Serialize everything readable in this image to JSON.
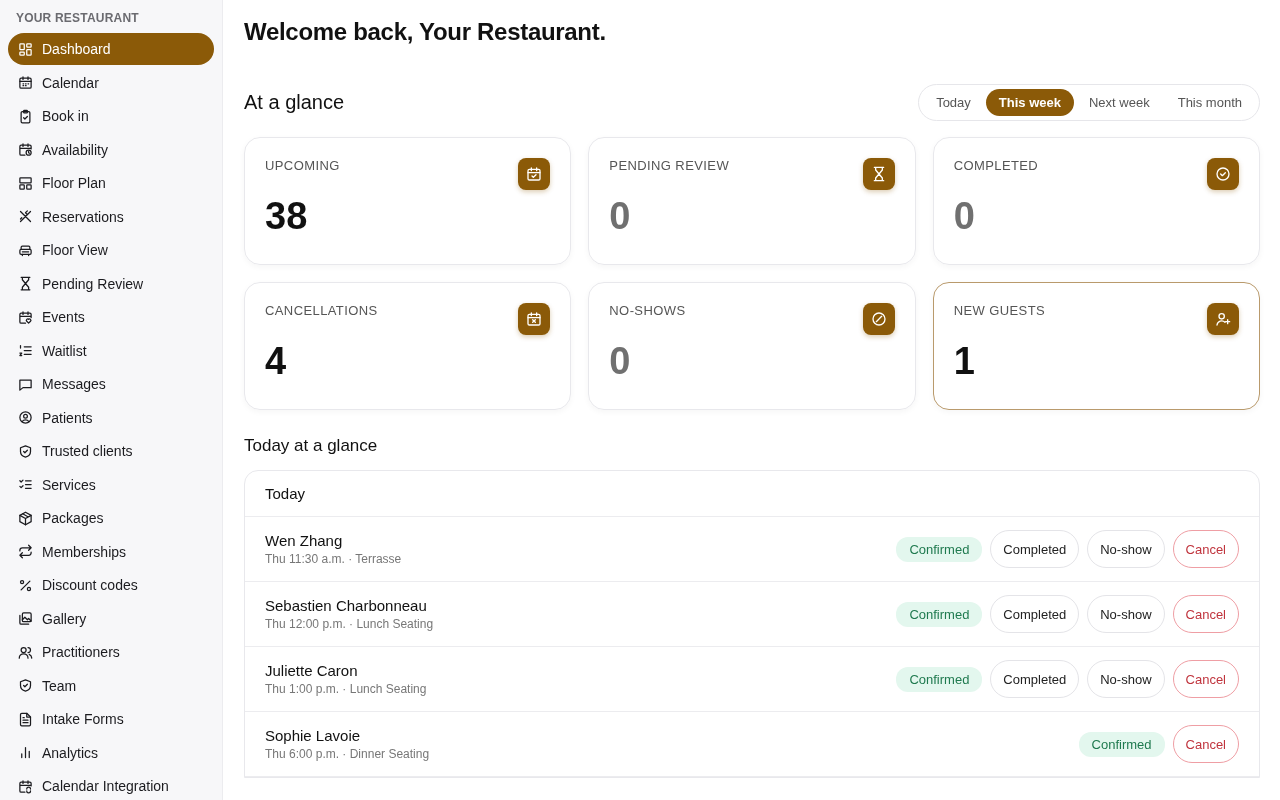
{
  "sidebar": {
    "heading": "YOUR RESTAURANT",
    "items": [
      {
        "label": "Dashboard",
        "selected": true
      },
      {
        "label": "Calendar",
        "selected": false
      },
      {
        "label": "Book in",
        "selected": false
      },
      {
        "label": "Availability",
        "selected": false
      },
      {
        "label": "Floor Plan",
        "selected": false
      },
      {
        "label": "Reservations",
        "selected": false
      },
      {
        "label": "Floor View",
        "selected": false
      },
      {
        "label": "Pending Review",
        "selected": false
      },
      {
        "label": "Events",
        "selected": false
      },
      {
        "label": "Waitlist",
        "selected": false
      },
      {
        "label": "Messages",
        "selected": false
      },
      {
        "label": "Patients",
        "selected": false
      },
      {
        "label": "Trusted clients",
        "selected": false
      },
      {
        "label": "Services",
        "selected": false
      },
      {
        "label": "Packages",
        "selected": false
      },
      {
        "label": "Memberships",
        "selected": false
      },
      {
        "label": "Discount codes",
        "selected": false
      },
      {
        "label": "Gallery",
        "selected": false
      },
      {
        "label": "Practitioners",
        "selected": false
      },
      {
        "label": "Team",
        "selected": false
      },
      {
        "label": "Intake Forms",
        "selected": false
      },
      {
        "label": "Analytics",
        "selected": false
      },
      {
        "label": "Calendar Integration",
        "selected": false
      }
    ]
  },
  "title": "Welcome back, Your Restaurant.",
  "glance": {
    "heading": "At a glance",
    "periods": [
      {
        "label": "Today",
        "selected": false
      },
      {
        "label": "This week",
        "selected": true
      },
      {
        "label": "Next week",
        "selected": false
      },
      {
        "label": "This month",
        "selected": false
      }
    ],
    "stats": [
      {
        "label": "UPCOMING",
        "value": "38",
        "dimmed": false,
        "highlighted": false
      },
      {
        "label": "PENDING REVIEW",
        "value": "0",
        "dimmed": true,
        "highlighted": false
      },
      {
        "label": "COMPLETED",
        "value": "0",
        "dimmed": true,
        "highlighted": false
      },
      {
        "label": "CANCELLATIONS",
        "value": "4",
        "dimmed": false,
        "highlighted": false
      },
      {
        "label": "NO-SHOWS",
        "value": "0",
        "dimmed": true,
        "highlighted": false
      },
      {
        "label": "NEW GUESTS",
        "value": "1",
        "dimmed": false,
        "highlighted": true
      }
    ]
  },
  "today": {
    "heading": "Today at a glance",
    "list_title": "Today",
    "rows": [
      {
        "name": "Wen Zhang",
        "detail": "Thu 11:30 a.m. · Terrasse",
        "actions": [
          {
            "kind": "status",
            "label": "Confirmed"
          },
          {
            "kind": "button",
            "label": "Completed"
          },
          {
            "kind": "button",
            "label": "No-show"
          },
          {
            "kind": "danger",
            "label": "Cancel"
          }
        ]
      },
      {
        "name": "Sebastien Charbonneau",
        "detail": "Thu 12:00 p.m. · Lunch Seating",
        "actions": [
          {
            "kind": "status",
            "label": "Confirmed"
          },
          {
            "kind": "button",
            "label": "Completed"
          },
          {
            "kind": "button",
            "label": "No-show"
          },
          {
            "kind": "danger",
            "label": "Cancel"
          }
        ]
      },
      {
        "name": "Juliette Caron",
        "detail": "Thu 1:00 p.m. · Lunch Seating",
        "actions": [
          {
            "kind": "status",
            "label": "Confirmed"
          },
          {
            "kind": "button",
            "label": "Completed"
          },
          {
            "kind": "button",
            "label": "No-show"
          },
          {
            "kind": "danger",
            "label": "Cancel"
          }
        ]
      },
      {
        "name": "Sophie Lavoie",
        "detail": "Thu 6:00 p.m. · Dinner Seating",
        "actions": [
          {
            "kind": "status",
            "label": "Confirmed"
          },
          {
            "kind": "danger",
            "label": "Cancel"
          }
        ]
      }
    ]
  }
}
